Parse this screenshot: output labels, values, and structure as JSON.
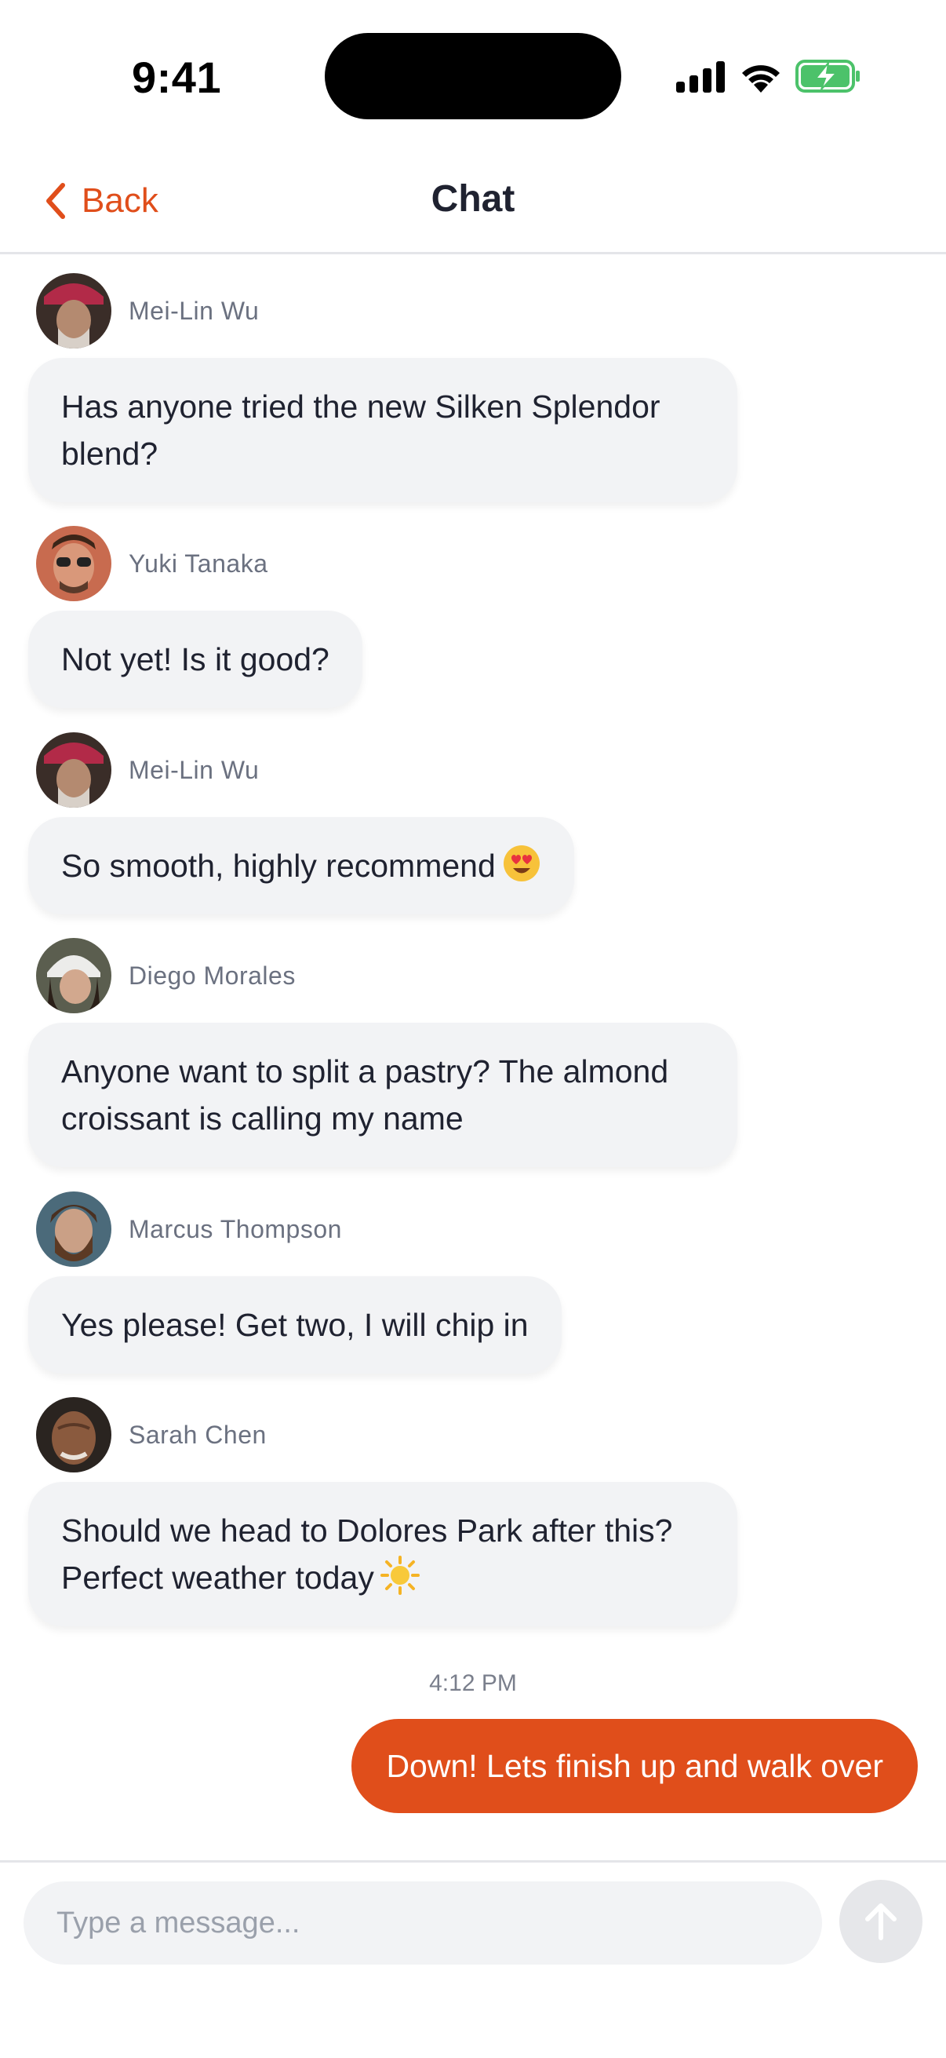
{
  "status_bar": {
    "time": "9:41"
  },
  "header": {
    "back_label": "Back",
    "title": "Chat"
  },
  "messages": [
    {
      "sender": "Mei-Lin Wu",
      "text": "Has anyone tried the new Silken Splendor blend?"
    },
    {
      "sender": "Yuki Tanaka",
      "text": "Not yet! Is it good?"
    },
    {
      "sender": "Mei-Lin Wu",
      "text": "So smooth, highly recommend",
      "emoji": "heart-eyes-emoji"
    },
    {
      "sender": "Diego Morales",
      "text": "Anyone want to split a pastry? The almond croissant is calling my name"
    },
    {
      "sender": "Marcus Thompson",
      "text": "Yes please! Get two, I will chip in"
    },
    {
      "sender": "Sarah Chen",
      "text": "Should we head to Dolores Park after this? Perfect weather today",
      "emoji": "sun-emoji"
    }
  ],
  "timestamp": "4:12 PM",
  "outgoing": {
    "text": "Down! Lets finish up and walk over"
  },
  "composer": {
    "placeholder": "Type a message..."
  },
  "colors": {
    "accent": "#e04e1b",
    "bubble": "#f2f3f5",
    "send_disabled": "#e6e7ea"
  }
}
